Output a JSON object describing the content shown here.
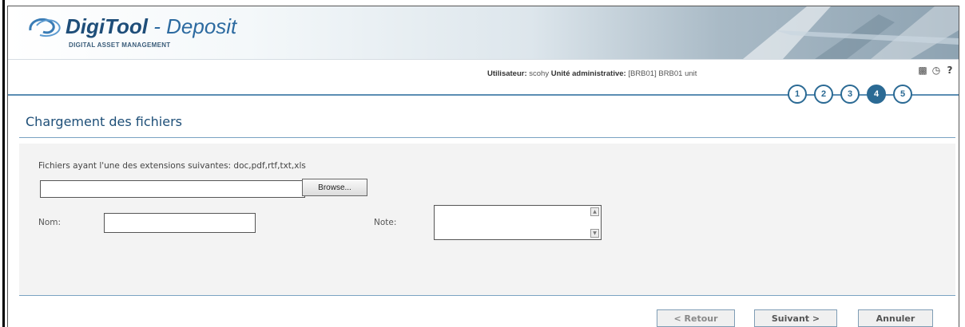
{
  "app": {
    "logo_name": "DigiTool",
    "logo_suffix": " - Deposit",
    "subtitle": "DIGITAL ASSET MANAGEMENT"
  },
  "userbar": {
    "user_label": "Utilisateur:",
    "user_value": "scohy",
    "unit_label": "Unité administrative:",
    "unit_value": "[BRB01] BRB01 unit",
    "icons": [
      "book-icon",
      "globe-icon",
      "help-icon"
    ],
    "help_glyph": "?"
  },
  "steps": [
    {
      "label": "1",
      "active": false
    },
    {
      "label": "2",
      "active": false
    },
    {
      "label": "3",
      "active": false
    },
    {
      "label": "4",
      "active": true
    },
    {
      "label": "5",
      "active": false
    }
  ],
  "page": {
    "title": "Chargement des fichiers",
    "extensions_text": "Fichiers ayant l'une des extensions suivantes: doc,pdf,rtf,txt,xls"
  },
  "form": {
    "file_value": "",
    "browse_label": "Browse...",
    "nom_label": "Nom:",
    "nom_value": "",
    "note_label": "Note:",
    "note_value": ""
  },
  "buttons": {
    "back": "< Retour",
    "next": "Suivant >",
    "cancel": "Annuler"
  },
  "colors": {
    "accent": "#2b6a94",
    "title": "#1d4e77"
  }
}
